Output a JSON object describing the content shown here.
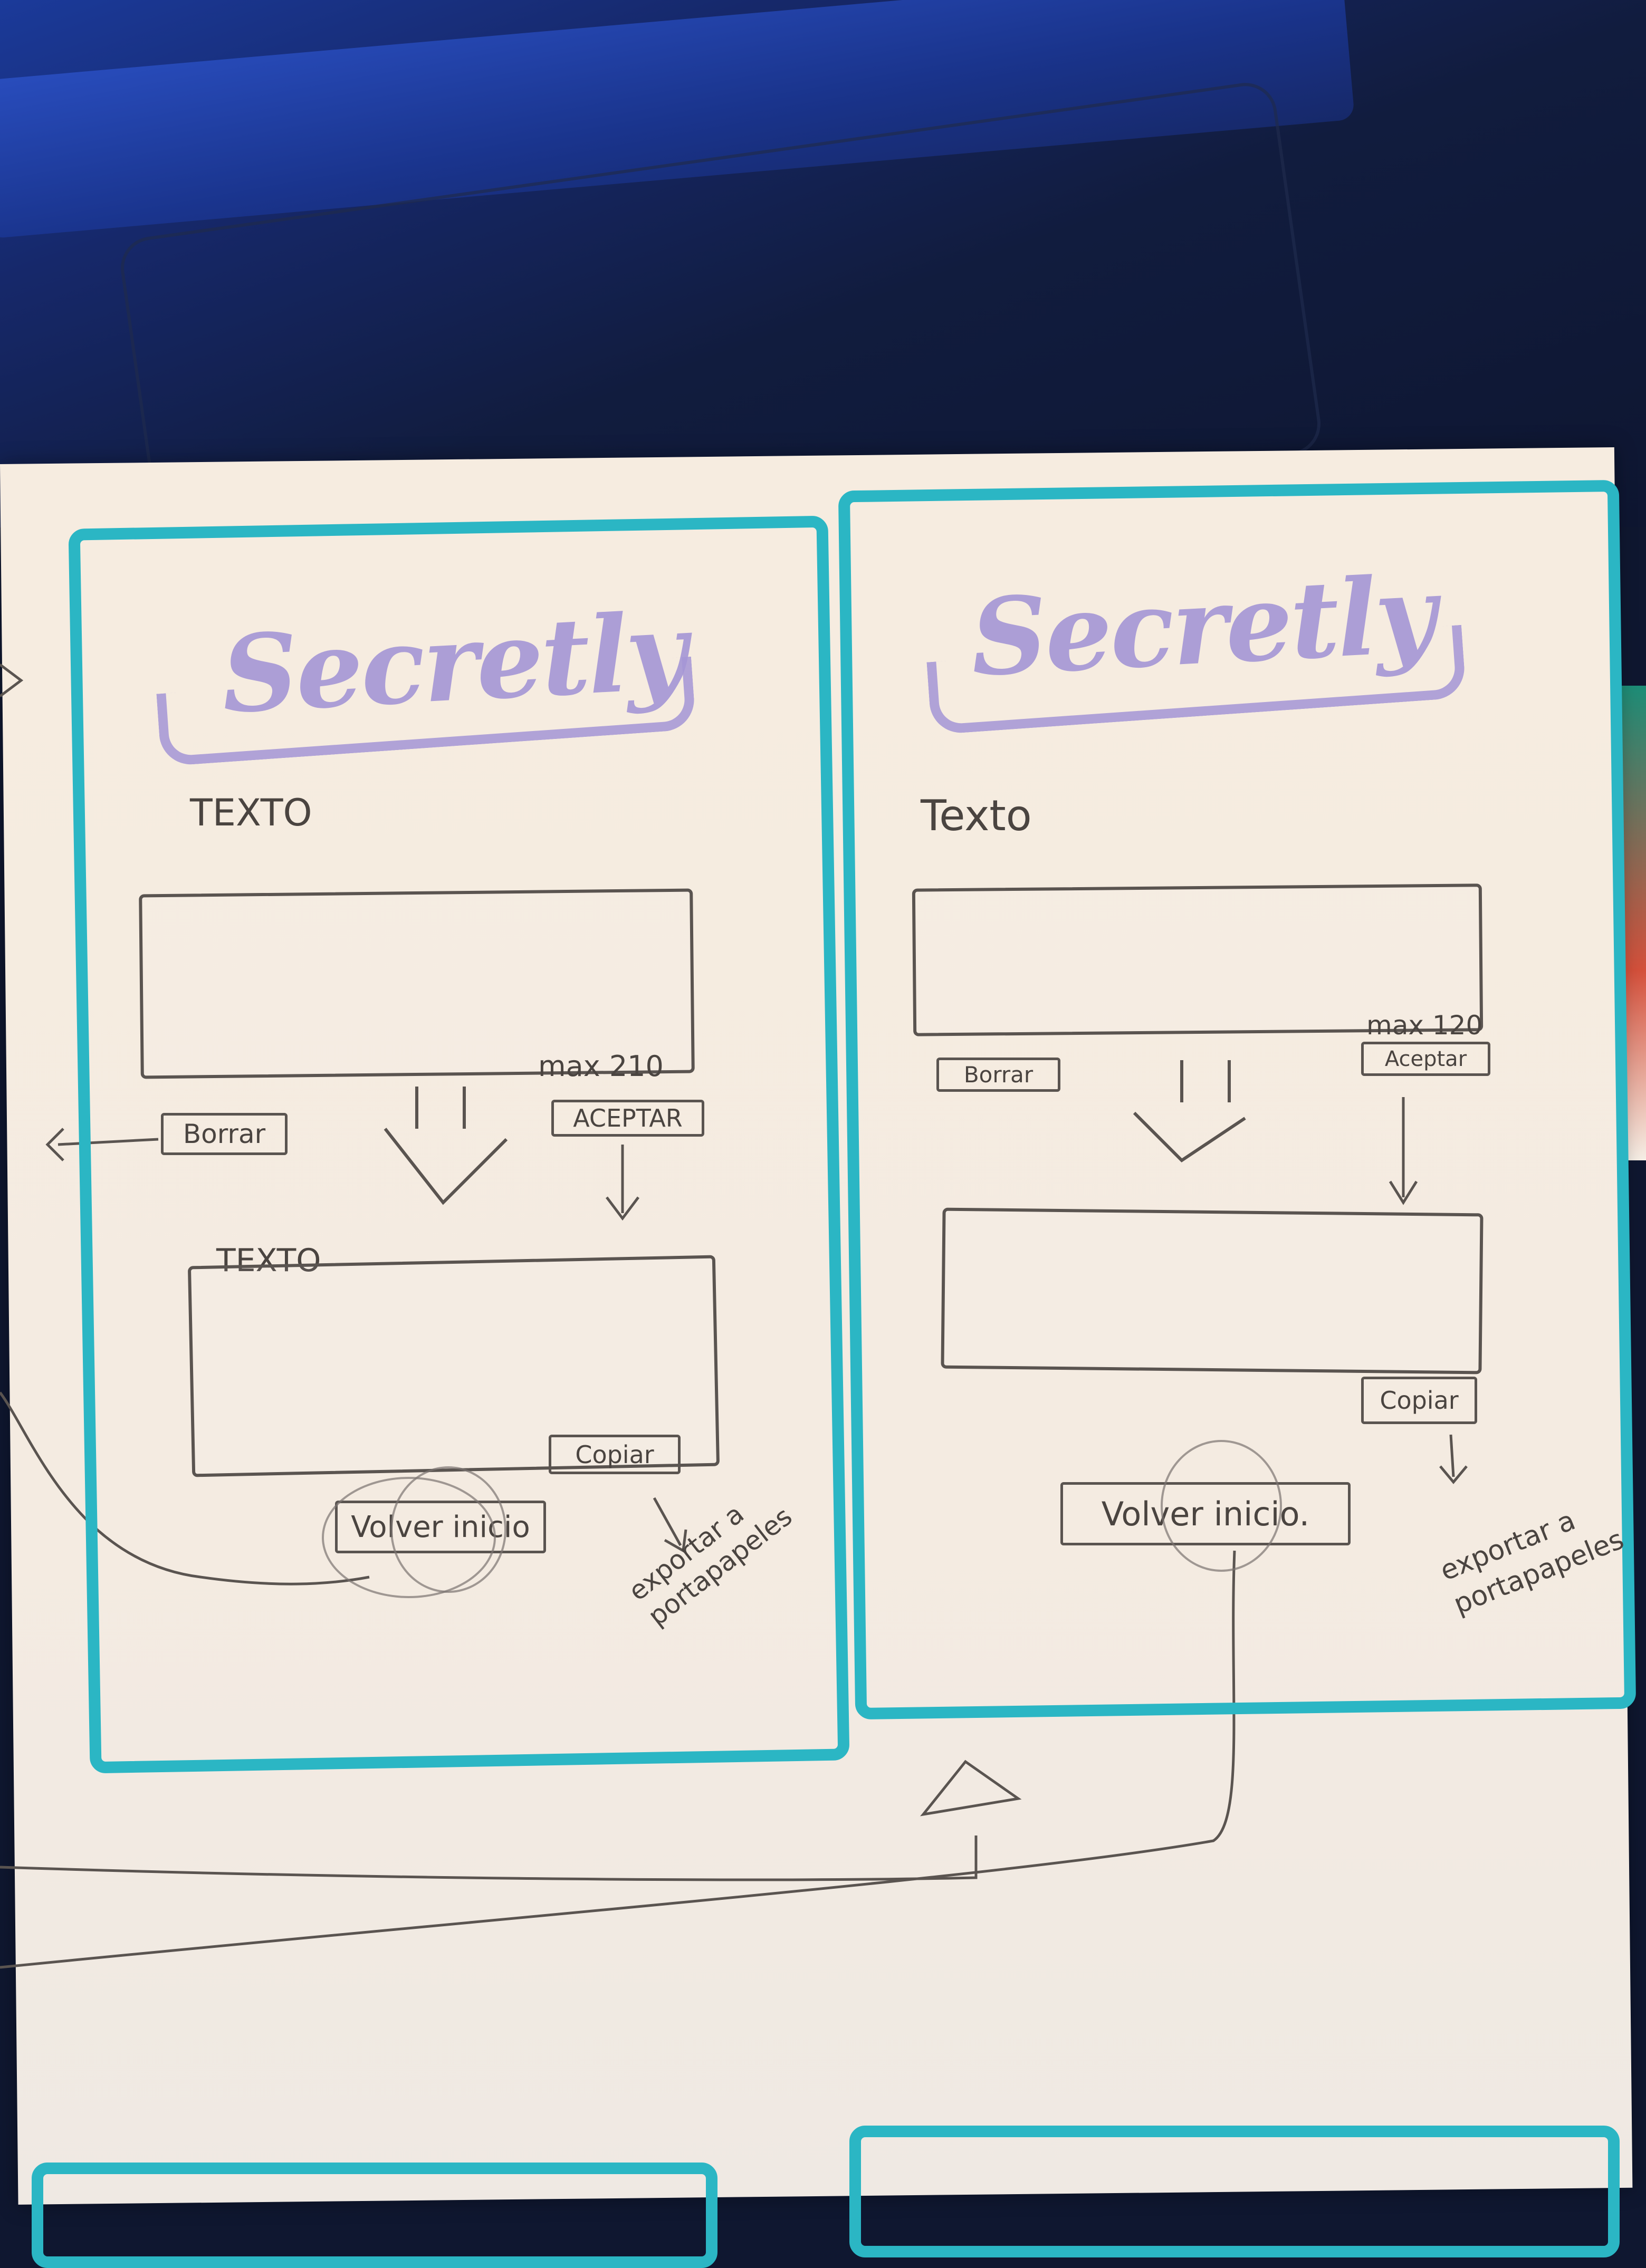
{
  "app_name": "Secretly",
  "screen_left": {
    "logo": "Secretly",
    "input_label": "TEXTO",
    "max_note": "max 210",
    "clear_button": "Borrar",
    "accept_button": "ACEPTAR",
    "output_label": "TEXTO",
    "copy_button": "Copiar",
    "home_button": "Volver inicio",
    "clipboard_note": "exportar a portapapeles"
  },
  "screen_right": {
    "logo": "Secretly",
    "input_label": "Texto",
    "max_note": "max 120",
    "clear_button": "Borrar",
    "accept_button": "Aceptar",
    "copy_button": "Copiar",
    "home_button": "Volver inicio.",
    "clipboard_note": "exportar a portapapeles"
  },
  "colors": {
    "frame": "#2bb6c4",
    "logo": "#a596d6",
    "pencil": "#4a4440",
    "paper": "#f6ece0"
  }
}
